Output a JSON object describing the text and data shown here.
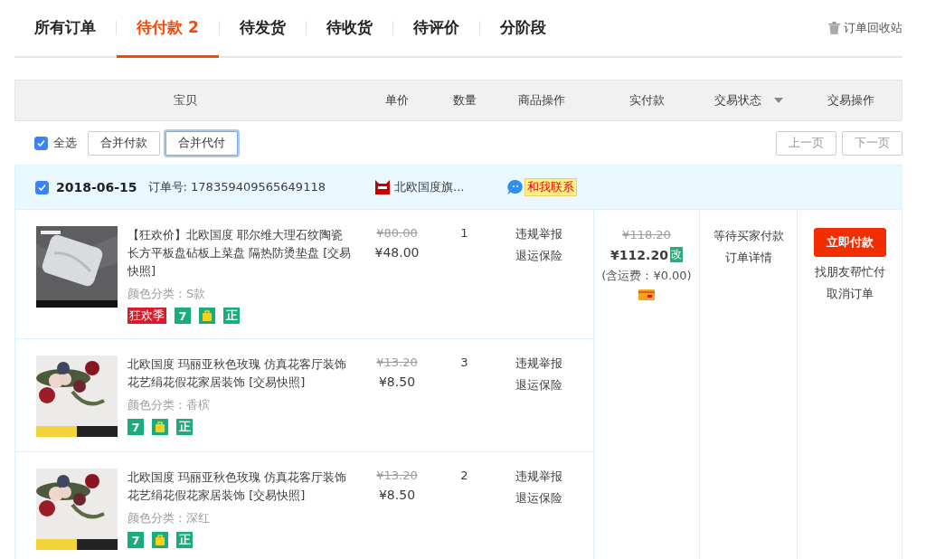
{
  "tabs": [
    {
      "label": "所有订单",
      "selected": false
    },
    {
      "label": "待付款 2",
      "selected": true
    },
    {
      "label": "待发货",
      "selected": false
    },
    {
      "label": "待收货",
      "selected": false
    },
    {
      "label": "待评价",
      "selected": false
    },
    {
      "label": "分阶段",
      "selected": false
    }
  ],
  "recycle_bin": {
    "label": "订单回收站"
  },
  "columns": [
    {
      "label": "宝贝",
      "kind": "plain"
    },
    {
      "label": "单价",
      "kind": "plain"
    },
    {
      "label": "数量",
      "kind": "plain"
    },
    {
      "label": "商品操作",
      "kind": "plain"
    },
    {
      "label": "实付款",
      "kind": "plain"
    },
    {
      "label": "交易状态",
      "kind": "filter"
    },
    {
      "label": "交易操作",
      "kind": "plain"
    }
  ],
  "toolbar": {
    "select_all": {
      "label": "全选",
      "checked": true
    },
    "buttons": [
      {
        "label": "合并付款",
        "focused": false
      },
      {
        "label": "合并代付",
        "focused": true
      }
    ],
    "pager": [
      {
        "label": "上一页",
        "disabled": true
      },
      {
        "label": "下一页",
        "disabled": true
      }
    ]
  },
  "orders": [
    {
      "checked": true,
      "date": "2018-06-15",
      "order_no": "订单号: 178359409565649118",
      "shop": "北欧国度旗...",
      "contact": "和我联系",
      "items": [
        {
          "title": "【狂欢价】北欧国度 耶尔维大理石纹陶瓷长方平板盘砧板上菜盘 隔热防烫垫盘 [交易快照]",
          "sku": "颜色分类：S款",
          "original_price": "¥80.00",
          "price": "¥48.00",
          "quantity": "1",
          "actions": [
            "违规举报",
            "退运保险"
          ],
          "badges": [
            {
              "kind": "label",
              "text": "狂欢季"
            },
            {
              "kind": "tile",
              "text": "7"
            },
            {
              "kind": "bag"
            },
            {
              "kind": "tile",
              "text": "正"
            }
          ]
        },
        {
          "title": "北欧国度 玛丽亚秋色玫瑰 仿真花客厅装饰花艺绢花假花家居装饰 [交易快照]",
          "sku": "颜色分类：香槟",
          "original_price": "¥13.20",
          "price": "¥8.50",
          "quantity": "3",
          "actions": [
            "违规举报",
            "退运保险"
          ],
          "badges": [
            {
              "kind": "tile",
              "text": "7"
            },
            {
              "kind": "bag"
            },
            {
              "kind": "tile",
              "text": "正"
            }
          ]
        },
        {
          "title": "北欧国度 玛丽亚秋色玫瑰 仿真花客厅装饰花艺绢花假花家居装饰 [交易快照]",
          "sku": "颜色分类：深红",
          "original_price": "¥13.20",
          "price": "¥8.50",
          "quantity": "2",
          "actions": [
            "违规举报",
            "退运保险"
          ],
          "badges": [
            {
              "kind": "tile",
              "text": "7"
            },
            {
              "kind": "bag"
            },
            {
              "kind": "tile",
              "text": "正"
            }
          ]
        }
      ],
      "total": {
        "original": "¥118.20",
        "amount": "¥112.20",
        "modify": "改",
        "shipping": "(含运费：¥0.00)"
      },
      "status": [
        "等待买家付款",
        "订单详情"
      ],
      "pay_button": "立即付款",
      "links": [
        "找朋友帮忙付",
        "取消订单"
      ]
    }
  ]
}
